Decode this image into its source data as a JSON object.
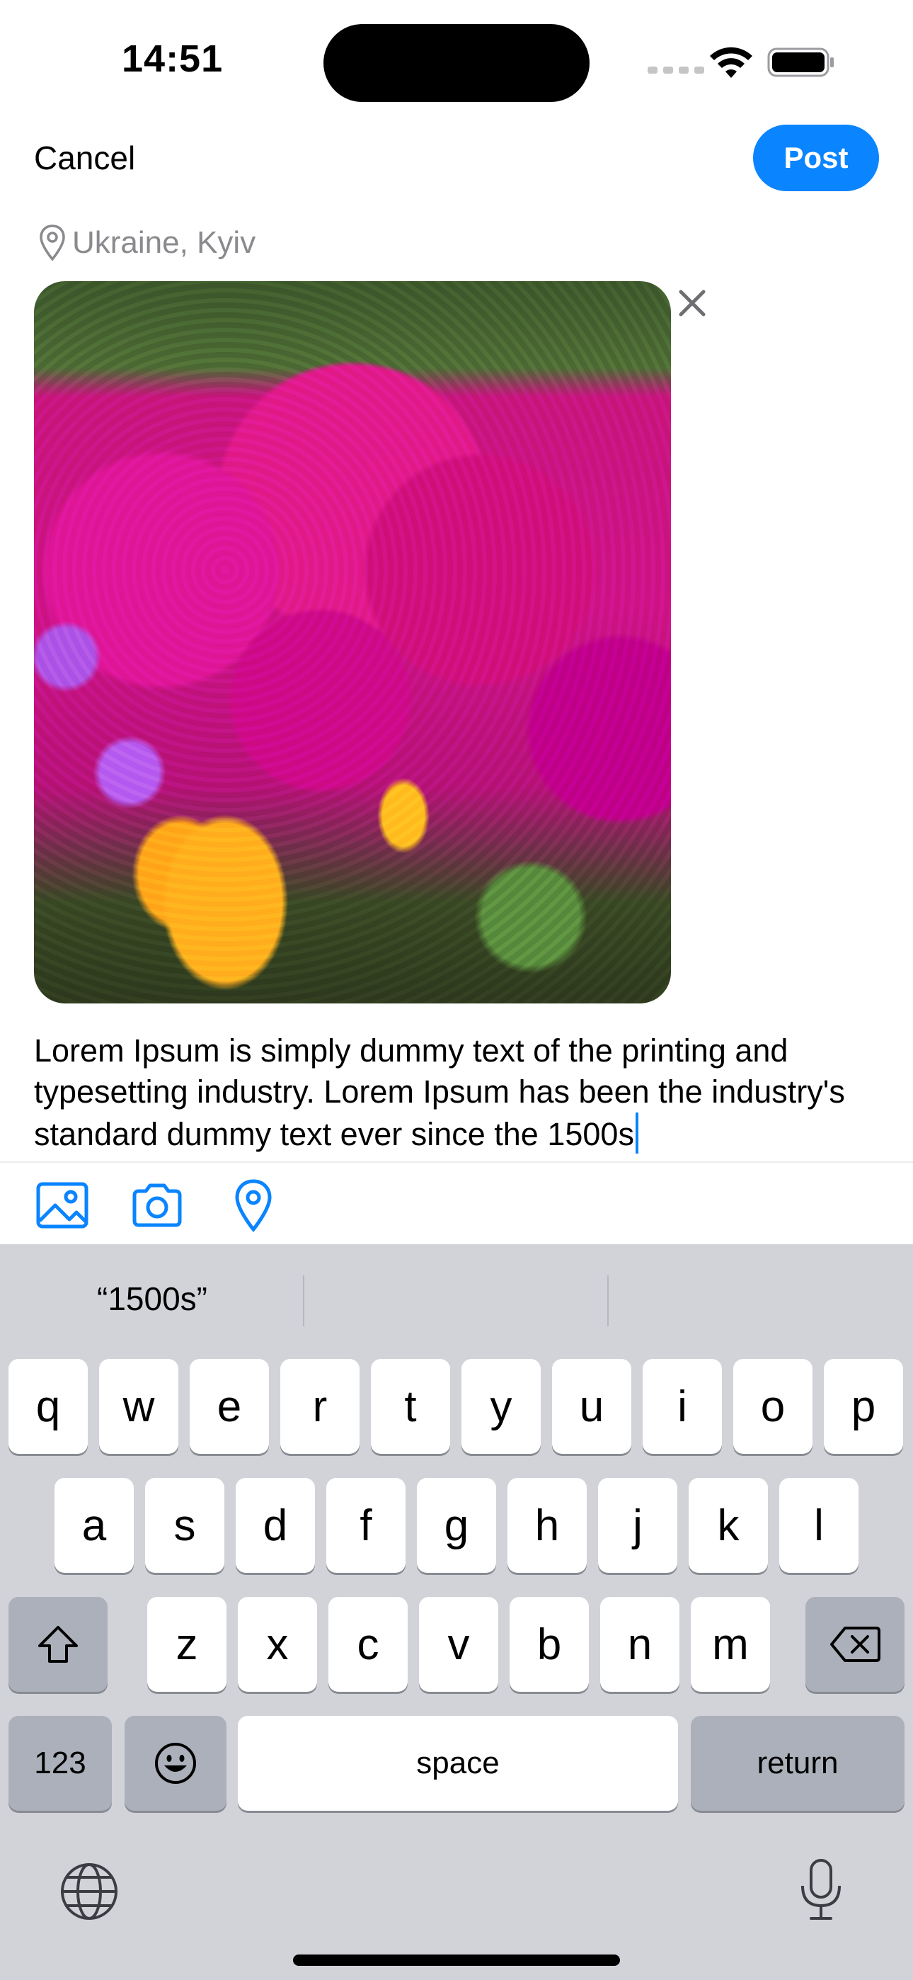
{
  "status_bar": {
    "time": "14:51"
  },
  "header": {
    "cancel_label": "Cancel",
    "post_label": "Post",
    "post_color": "#0a84ff"
  },
  "location": {
    "label": "Ukraine, Kyiv",
    "icon": "location-pin-icon"
  },
  "photo": {
    "description_icon": "remove-photo-icon"
  },
  "post": {
    "text": "Lorem Ipsum is simply dummy text of the printing and typesetting industry. Lorem Ipsum has been the industry's standard dummy text ever since the 1500s"
  },
  "toolbar": {
    "items": [
      {
        "icon": "gallery-icon"
      },
      {
        "icon": "camera-icon"
      },
      {
        "icon": "location-icon"
      }
    ]
  },
  "keyboard": {
    "suggestions": [
      "“1500s”",
      "",
      ""
    ],
    "row1": [
      "q",
      "w",
      "e",
      "r",
      "t",
      "y",
      "u",
      "i",
      "o",
      "p"
    ],
    "row2": [
      "a",
      "s",
      "d",
      "f",
      "g",
      "h",
      "j",
      "k",
      "l"
    ],
    "row3": [
      "z",
      "x",
      "c",
      "v",
      "b",
      "n",
      "m"
    ],
    "numbers_label": "123",
    "space_label": "space",
    "return_label": "return"
  }
}
